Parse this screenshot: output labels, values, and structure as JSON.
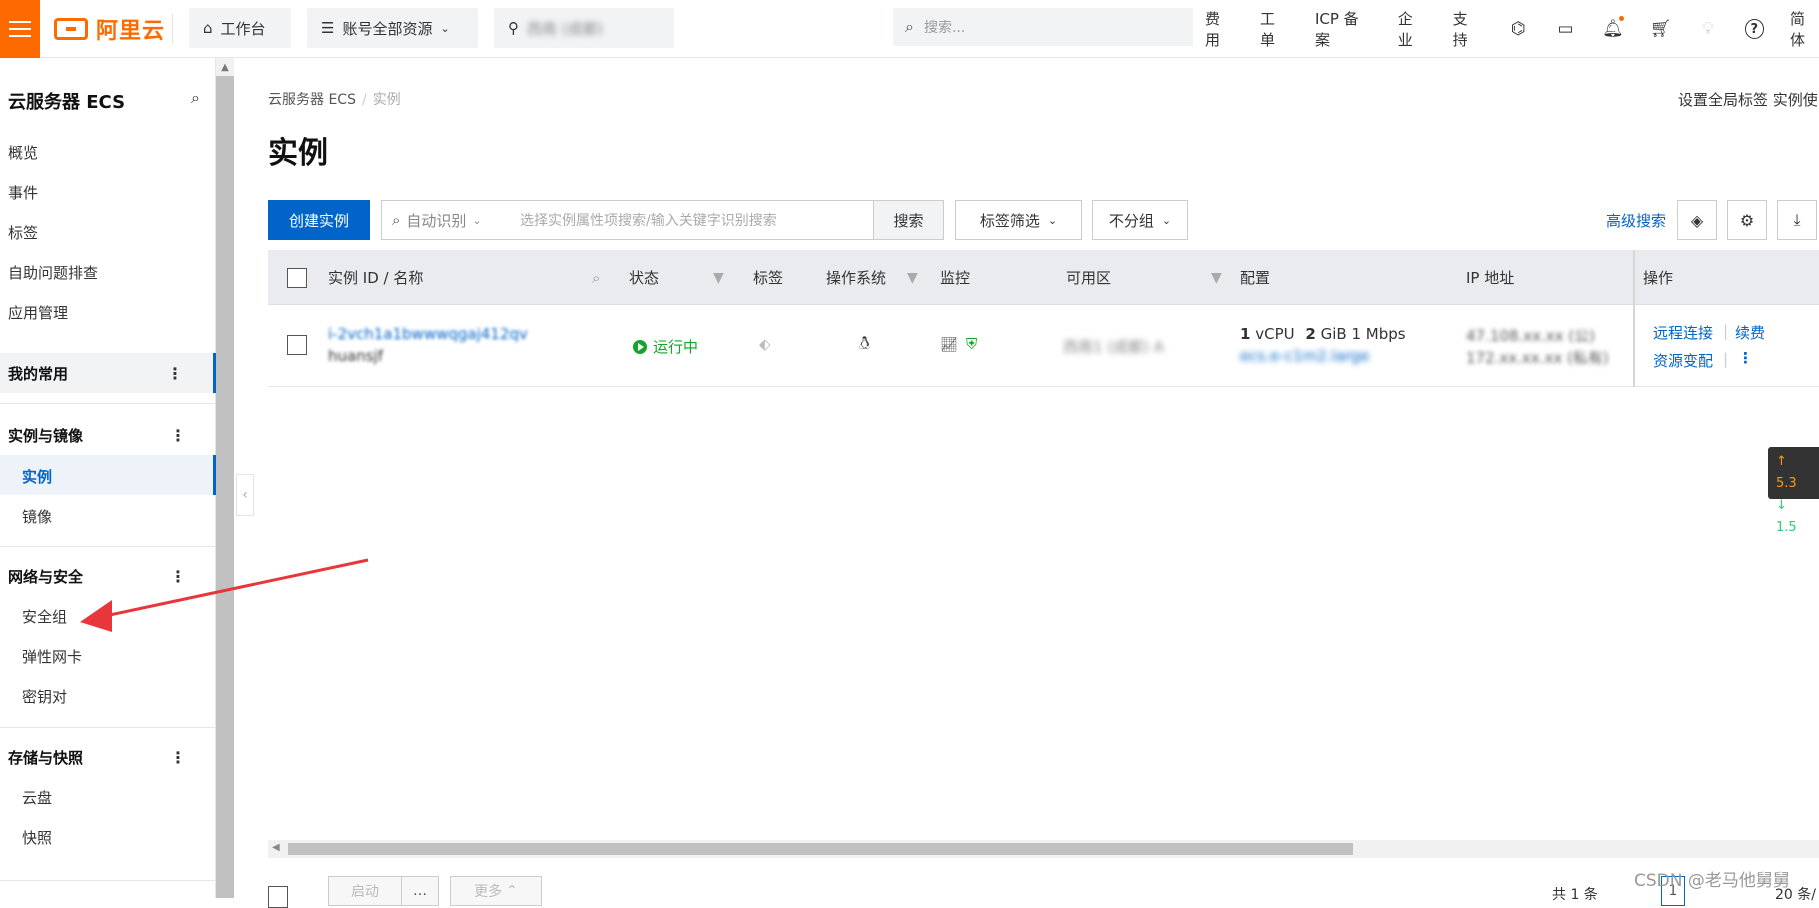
{
  "topbar": {
    "logo_text": "阿里云",
    "workbench": "工作台",
    "resources": "账号全部资源",
    "region": "西南 (成都)",
    "search_placeholder": "搜索...",
    "links": [
      "费用",
      "工单",
      "ICP 备案",
      "企业",
      "支持"
    ],
    "lang": "简体"
  },
  "sidebar": {
    "title": "云服务器 ECS",
    "top_items": [
      "概览",
      "事件",
      "标签",
      "自助问题排查",
      "应用管理"
    ],
    "favorites": "我的常用",
    "groups": [
      {
        "label": "实例与镜像",
        "items": [
          "实例",
          "镜像"
        ]
      },
      {
        "label": "网络与安全",
        "items": [
          "安全组",
          "弹性网卡",
          "密钥对"
        ]
      },
      {
        "label": "存储与快照",
        "items": [
          "云盘",
          "快照"
        ]
      }
    ]
  },
  "main": {
    "breadcrumb": [
      "云服务器 ECS",
      "实例"
    ],
    "title": "实例",
    "global_links": "设置全局标签   实例使",
    "create_button": "创建实例",
    "search_type": "自动识别",
    "search_placeholder": "选择实例属性项搜索/输入关键字识别搜索",
    "search_button": "搜索",
    "tag_filter": "标签筛选",
    "group_select": "不分组",
    "advanced_search": "高级搜索"
  },
  "table": {
    "headers": [
      "实例 ID / 名称",
      "状态",
      "标签",
      "操作系统",
      "监控",
      "可用区",
      "配置",
      "IP 地址",
      "操作"
    ],
    "rows": [
      {
        "instance_id": "i-2vch1a1bwwwqgaj412qv",
        "name": "huansjf",
        "status": "运行中",
        "zone": "西南1 (成都) A",
        "config_cpu": "1",
        "config_cpu_unit": "vCPU",
        "config_mem": "2",
        "config_mem_unit": "GiB",
        "config_bw": "1 Mbps",
        "config_type": "ecs.e-c1m2.large",
        "ip_public": "47.108.xx.xx (公)",
        "ip_private": "172.xx.xx.xx (私有)",
        "actions": [
          "远程连接",
          "续费",
          "资源变配"
        ]
      }
    ]
  },
  "footer": {
    "start": "启动",
    "more": "更多",
    "total": "共 1 条",
    "page": "1",
    "page_size": "20 条/"
  },
  "netmon": {
    "up": "5.3",
    "down": "1.5"
  },
  "watermark": "CSDN @老马他舅舅",
  "colors": {
    "brand": "#ff6a00",
    "primary": "#0064c8",
    "running": "#15a32c"
  }
}
